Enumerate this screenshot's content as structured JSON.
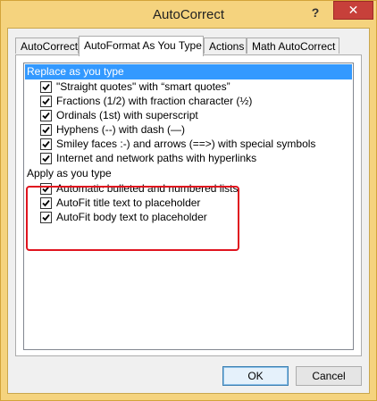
{
  "window": {
    "title": "AutoCorrect",
    "help_label": "?",
    "close_label": "✕",
    "frame_color": "#f5d37e",
    "close_color": "#c7403a"
  },
  "tabs": [
    {
      "label": "AutoCorrect",
      "active": false
    },
    {
      "label": "AutoFormat As You Type",
      "active": true
    },
    {
      "label": "Actions",
      "active": false
    },
    {
      "label": "Math AutoCorrect",
      "active": false
    }
  ],
  "groups": {
    "replace": {
      "header": "Replace as you type",
      "selected": true,
      "items": [
        {
          "label": "\"Straight quotes\" with “smart quotes”",
          "checked": true
        },
        {
          "label": "Fractions (1/2) with fraction character (½)",
          "checked": true
        },
        {
          "label": "Ordinals (1st) with superscript",
          "checked": true
        },
        {
          "label": "Hyphens (--) with dash (—)",
          "checked": true
        },
        {
          "label": "Smiley faces :-) and arrows (==>) with special symbols",
          "checked": true
        },
        {
          "label": "Internet and network paths with hyperlinks",
          "checked": true
        }
      ]
    },
    "apply": {
      "header": "Apply as you type",
      "selected": false,
      "items": [
        {
          "label": "Automatic bulleted and numbered lists",
          "checked": true
        },
        {
          "label": "AutoFit title text to placeholder",
          "checked": true
        },
        {
          "label": "AutoFit body text to placeholder",
          "checked": true
        }
      ]
    }
  },
  "buttons": {
    "ok": "OK",
    "cancel": "Cancel"
  },
  "highlight_color": "#e0141f",
  "selection_color": "#3399ff"
}
